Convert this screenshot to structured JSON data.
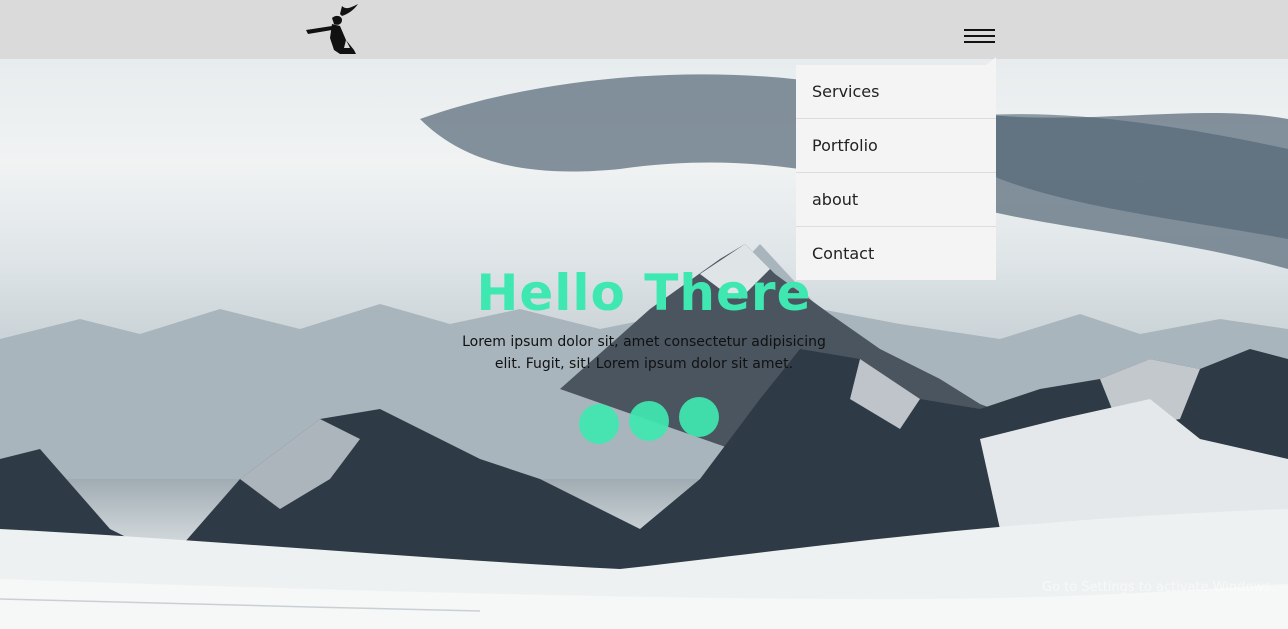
{
  "header": {
    "logo_alt": "samurai logo",
    "menu_icon": "hamburger-icon"
  },
  "dropdown": {
    "items": [
      {
        "label": "Services"
      },
      {
        "label": "Portfolio"
      },
      {
        "label": "about"
      },
      {
        "label": "Contact"
      }
    ]
  },
  "hero": {
    "title": "Hello There",
    "text_line1": "Lorem ipsum dolor sit, amet consectetur adipisicing",
    "text_line2": "elit. Fugit, sit! Lorem ipsum dolor sit amet.",
    "dots_count": "3"
  },
  "watermark": "Go to Settings to activate Windows.",
  "colors": {
    "accent": "#3fe8b0",
    "header_bg": "#dadada",
    "dropdown_bg": "#f4f4f4"
  }
}
